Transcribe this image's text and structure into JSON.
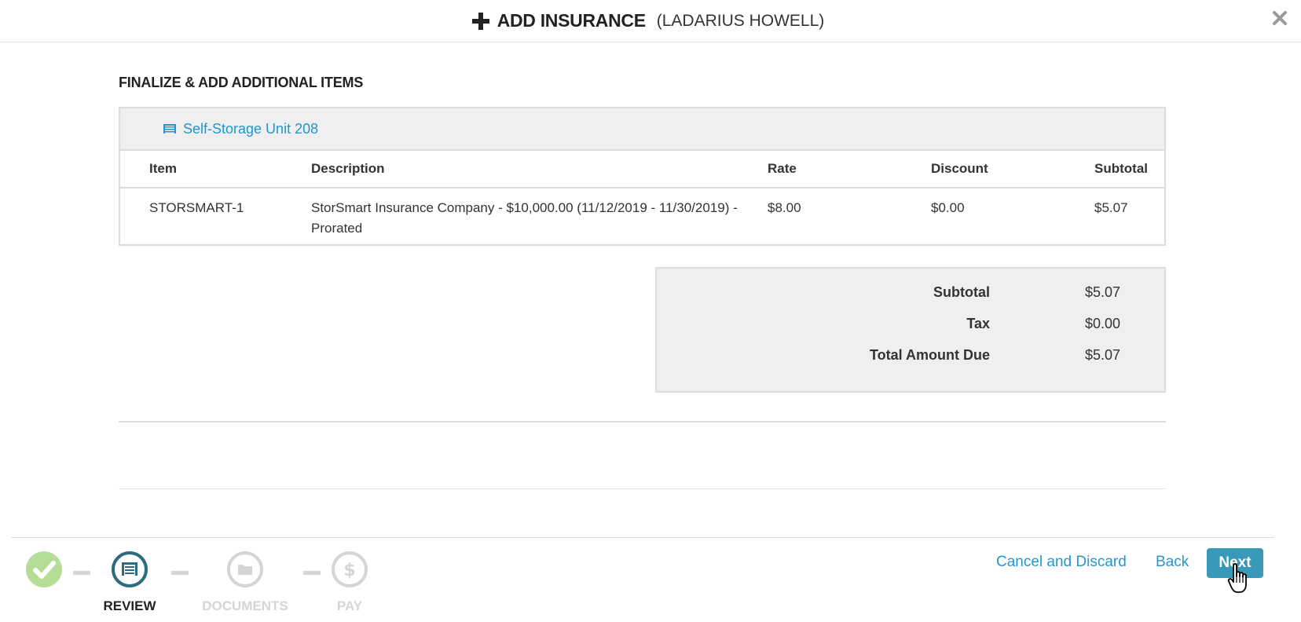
{
  "header": {
    "title": "ADD INSURANCE",
    "subtitle": "(LADARIUS HOWELL)",
    "icon": "plus-icon",
    "close_icon": "close-icon"
  },
  "section": {
    "title": "FINALIZE & ADD ADDITIONAL ITEMS"
  },
  "unit": {
    "label": "Self-Storage Unit 208",
    "icon": "storage-unit-icon"
  },
  "table": {
    "columns": [
      "Item",
      "Description",
      "Rate",
      "Discount",
      "Subtotal"
    ],
    "rows": [
      {
        "item": "STORSMART-1",
        "description": "StorSmart Insurance Company - $10,000.00 (11/12/2019 - 11/30/2019) - Prorated",
        "rate": "$8.00",
        "discount": "$0.00",
        "subtotal": "$5.07"
      }
    ]
  },
  "totals": {
    "subtotal_label": "Subtotal",
    "subtotal_value": "$5.07",
    "tax_label": "Tax",
    "tax_value": "$0.00",
    "total_label": "Total Amount Due",
    "total_value": "$5.07"
  },
  "steps": [
    {
      "label": "",
      "state": "complete",
      "icon": "checkmark-icon"
    },
    {
      "label": "REVIEW",
      "state": "active",
      "icon": "storage-unit-icon"
    },
    {
      "label": "DOCUMENTS",
      "state": "pending",
      "icon": "folder-icon"
    },
    {
      "label": "PAY",
      "state": "pending",
      "icon": "dollar-icon"
    }
  ],
  "actions": {
    "cancel_label": "Cancel and Discard",
    "back_label": "Back",
    "next_label": "Next"
  },
  "colors": {
    "accent": "#2196cf",
    "button": "#3a98b9",
    "step_active": "#2c6b80",
    "step_complete": "#b6dd98",
    "step_pending": "#d5d5d5"
  }
}
